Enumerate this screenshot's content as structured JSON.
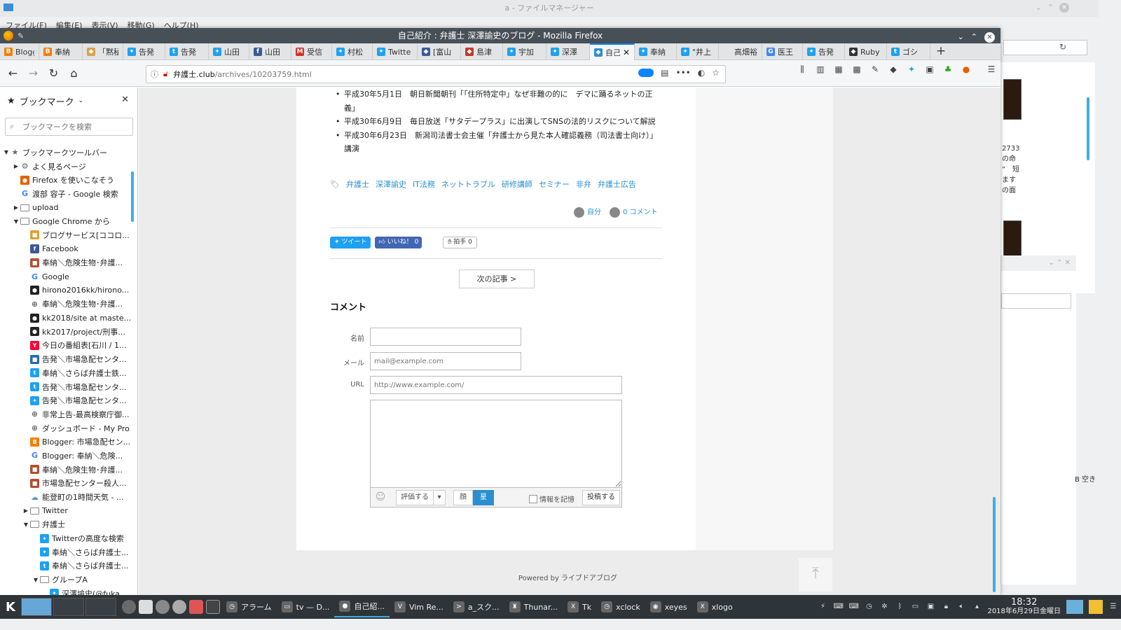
{
  "fm": {
    "title": "a - ファイルマネージャー",
    "menu": [
      "ファイル(F)",
      "編集(E)",
      "表示(V)",
      "移動(G)",
      "ヘルプ(H)"
    ],
    "side_text": [
      "2733",
      "の命",
      "”　短",
      "ます",
      "の面"
    ],
    "status": "B 空き"
  },
  "browser": {
    "title": "自己紹介 : 弁護士 深澤諭史のブログ - Mozilla Firefox",
    "tabs": [
      {
        "label": "Blogg",
        "icon": "blogger-icon",
        "color": "#f57d00"
      },
      {
        "label": "奉納",
        "icon": "blogger-icon",
        "color": "#f57d00"
      },
      {
        "label": "「黙秘",
        "icon": "site-icon",
        "color": "#d9a04a"
      },
      {
        "label": "告発",
        "icon": "twitter-icon",
        "color": "#1da1f2"
      },
      {
        "label": "告発",
        "icon": "tumblr-icon",
        "color": "#1da1f2"
      },
      {
        "label": "山田",
        "icon": "twitter-icon",
        "color": "#1da1f2"
      },
      {
        "label": "山田",
        "icon": "facebook-icon",
        "color": "#3b5998"
      },
      {
        "label": "受信",
        "icon": "gmail-icon",
        "color": "#d93025"
      },
      {
        "label": "村松",
        "icon": "twitter-icon",
        "color": "#1da1f2"
      },
      {
        "label": "Twitte",
        "icon": "twitter-icon",
        "color": "#1da1f2"
      },
      {
        "label": "[富山",
        "icon": "site-icon",
        "color": "#3c5a99"
      },
      {
        "label": "島津",
        "icon": "site-icon",
        "color": "#c0392b"
      },
      {
        "label": "宇加",
        "icon": "twitter-icon",
        "color": "#1da1f2"
      },
      {
        "label": "深澤",
        "icon": "twitter-icon",
        "color": "#1da1f2"
      },
      {
        "label": "自己紹",
        "icon": "site-icon",
        "color": "#2a8fd0",
        "active": true
      },
      {
        "label": "奉納",
        "icon": "twitter-icon",
        "color": "#1da1f2"
      },
      {
        "label": "\"井上",
        "icon": "twitter-icon",
        "color": "#1da1f2"
      },
      {
        "label": "高畑裕太",
        "icon": "none",
        "color": "#e3e4e6"
      },
      {
        "label": "医王",
        "icon": "google-icon",
        "color": "#4285f4"
      },
      {
        "label": "告発",
        "icon": "twitter-icon",
        "color": "#1da1f2"
      },
      {
        "label": "Ruby",
        "icon": "site-icon",
        "color": "#333333"
      },
      {
        "label": "ゴシ",
        "icon": "tumblr-icon",
        "color": "#1da1f2"
      }
    ],
    "url_host": "弁護士.club",
    "url_path": "/archives/10203759.html"
  },
  "sidebar": {
    "title": "ブックマーク",
    "search_placeholder": "ブックマークを検索",
    "items": [
      {
        "label": "ブックマークツールバー",
        "indent": 0,
        "twisty": "▼",
        "icon": "star-folder-icon",
        "color": "#666666"
      },
      {
        "label": "よく見るページ",
        "indent": 1,
        "twisty": "▶",
        "icon": "gear-icon",
        "color": "#666666"
      },
      {
        "label": "Firefox を使いこなそう",
        "indent": 1,
        "twisty": "",
        "icon": "firefox-icon",
        "color": "#e66000"
      },
      {
        "label": "渡部 容子 - Google 検索",
        "indent": 1,
        "twisty": "",
        "icon": "google-icon",
        "color": "#4285f4"
      },
      {
        "label": "upload",
        "indent": 1,
        "twisty": "▶",
        "icon": "folder-icon",
        "color": "#888888"
      },
      {
        "label": "Google Chrome から",
        "indent": 1,
        "twisty": "▼",
        "icon": "folder-icon",
        "color": "#888888"
      },
      {
        "label": "ブログサービス[ココロ...",
        "indent": 2,
        "twisty": "",
        "icon": "site-icon",
        "color": "#e0a030"
      },
      {
        "label": "Facebook",
        "indent": 2,
        "twisty": "",
        "icon": "facebook-icon",
        "color": "#3b5998"
      },
      {
        "label": "奉納＼危険生物･弁護...",
        "indent": 2,
        "twisty": "",
        "icon": "site-icon",
        "color": "#b05030"
      },
      {
        "label": "Google",
        "indent": 2,
        "twisty": "",
        "icon": "google-icon",
        "color": "#4285f4"
      },
      {
        "label": "hirono2016kk/hirono...",
        "indent": 2,
        "twisty": "",
        "icon": "github-icon",
        "color": "#222222"
      },
      {
        "label": "奉納＼危険生物･弁護...",
        "indent": 2,
        "twisty": "",
        "icon": "globe-icon",
        "color": "#666666"
      },
      {
        "label": "kk2018/site at maste...",
        "indent": 2,
        "twisty": "",
        "icon": "github-icon",
        "color": "#222222"
      },
      {
        "label": "kk2017/project/刑事...",
        "indent": 2,
        "twisty": "",
        "icon": "github-icon",
        "color": "#222222"
      },
      {
        "label": "今日の番組表[石川 / 1...",
        "indent": 2,
        "twisty": "",
        "icon": "yahoo-icon",
        "color": "#ff0033"
      },
      {
        "label": "告発＼市場急配センタ...",
        "indent": 2,
        "twisty": "",
        "icon": "site-icon",
        "color": "#2a6ab0"
      },
      {
        "label": "奉納＼さらば弁護士鉄...",
        "indent": 2,
        "twisty": "",
        "icon": "tumblr-icon",
        "color": "#1da1f2"
      },
      {
        "label": "告発＼市場急配センタ...",
        "indent": 2,
        "twisty": "",
        "icon": "tumblr-icon",
        "color": "#1da1f2"
      },
      {
        "label": "告発＼市場急配センタ...",
        "indent": 2,
        "twisty": "",
        "icon": "twitter-icon",
        "color": "#1da1f2"
      },
      {
        "label": "非常上告-最高検察庁御...",
        "indent": 2,
        "twisty": "",
        "icon": "globe-icon",
        "color": "#666666"
      },
      {
        "label": "ダッシュボード - My Pro...",
        "indent": 2,
        "twisty": "",
        "icon": "globe-icon",
        "color": "#666666"
      },
      {
        "label": "Blogger: 市場急配セン...",
        "indent": 2,
        "twisty": "",
        "icon": "blogger-icon",
        "color": "#f57d00"
      },
      {
        "label": "Blogger: 奉納＼危険...",
        "indent": 2,
        "twisty": "",
        "icon": "google-icon",
        "color": "#4285f4"
      },
      {
        "label": "奉納＼危険生物･弁護...",
        "indent": 2,
        "twisty": "",
        "icon": "site-icon",
        "color": "#b05030"
      },
      {
        "label": "市場急配センター殺人...",
        "indent": 2,
        "twisty": "",
        "icon": "site-icon",
        "color": "#b05030"
      },
      {
        "label": "能登町の1時間天気 - ...",
        "indent": 2,
        "twisty": "",
        "icon": "weather-icon",
        "color": "#5a8fd0"
      },
      {
        "label": "Twitter",
        "indent": 2,
        "twisty": "▶",
        "icon": "folder-icon",
        "color": "#888888"
      },
      {
        "label": "弁護士",
        "indent": 2,
        "twisty": "▼",
        "icon": "folder-icon",
        "color": "#888888"
      },
      {
        "label": "Twitterの高度な検索",
        "indent": 3,
        "twisty": "",
        "icon": "twitter-icon",
        "color": "#1da1f2"
      },
      {
        "label": "奉納＼さらば弁護士...",
        "indent": 3,
        "twisty": "",
        "icon": "twitter-icon",
        "color": "#1da1f2"
      },
      {
        "label": "奉納＼さらば弁護士...",
        "indent": 3,
        "twisty": "",
        "icon": "tumblr-icon",
        "color": "#1da1f2"
      },
      {
        "label": "グループA",
        "indent": 3,
        "twisty": "▼",
        "icon": "folder-icon",
        "color": "#888888"
      },
      {
        "label": "深澤諭史(@fuka...",
        "indent": 4,
        "twisty": "",
        "icon": "twitter-icon",
        "color": "#1da1f2"
      }
    ]
  },
  "page": {
    "news": [
      "平成30年5月1日　朝日新聞朝刊「「住所特定中」なぜ非難の的に　デマに踊るネットの正義」",
      "平成30年6月9日　毎日放送「サタデープラス」に出演してSNSの法的リスクについて解説",
      "平成30年6月23日　新潟司法書士会主催「弁護士から見た本人確認義務（司法書士向け）」講演"
    ],
    "tags": [
      "弁護士",
      "深澤諭史",
      "IT法務",
      "ネットトラブル",
      "研修講師",
      "セミナー",
      "非弁",
      "弁護士広告"
    ],
    "author": "自分",
    "comments_count": "0 コメント",
    "share": {
      "tweet": "ツイート",
      "like": "いいね！ 0",
      "clap": "拍手 0"
    },
    "next": "次の記事 >",
    "comment_heading": "コメント",
    "form": {
      "name_label": "名前",
      "mail_label": "メール",
      "mail_placeholder": "mail@example.com",
      "url_label": "URL",
      "url_placeholder": "http://www.example.com/",
      "eval": "評価する",
      "face": "顔",
      "star": "星",
      "remember": "情報を記憶",
      "post": "投稿する"
    },
    "powered": "Powered by ライブドアブログ"
  },
  "taskbar": {
    "tasks": [
      {
        "label": "アラーム",
        "icon": "alarm-icon"
      },
      {
        "label": "tv — D...",
        "icon": "folder-icon"
      },
      {
        "label": "自己紹...",
        "icon": "firefox-icon",
        "active": true
      },
      {
        "label": "Vim Re...",
        "icon": "vim-icon"
      },
      {
        "label": "a_スク...",
        "icon": "terminal-icon"
      },
      {
        "label": "Thunar...",
        "icon": "thunar-icon"
      },
      {
        "label": "Tk",
        "icon": "x-icon"
      },
      {
        "label": "xclock",
        "icon": "clock-icon"
      },
      {
        "label": "xeyes",
        "icon": "eyes-icon"
      },
      {
        "label": "xlogo",
        "icon": "x-icon"
      }
    ],
    "time": "18:32",
    "date": "2018年6月29日金曜日"
  }
}
